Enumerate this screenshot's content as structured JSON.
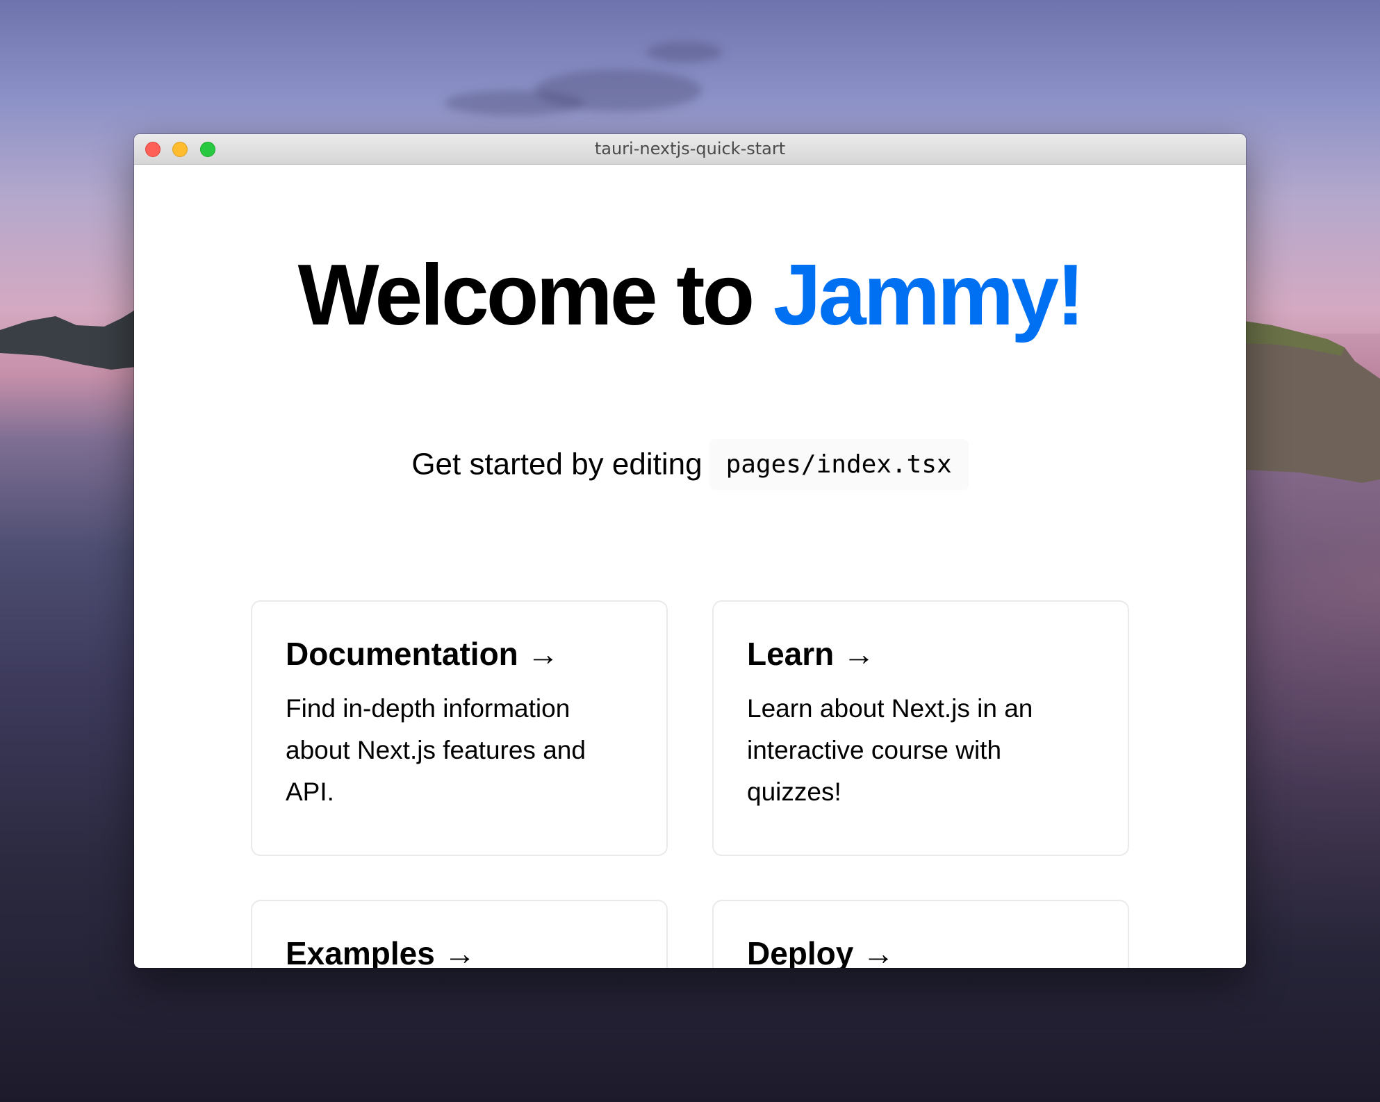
{
  "window": {
    "title": "tauri-nextjs-quick-start"
  },
  "main": {
    "title_prefix": "Welcome to ",
    "title_accent": "Jammy!",
    "description": "Get started by editing",
    "code": "pages/index.tsx"
  },
  "cards": [
    {
      "title": "Documentation →",
      "text": "Find in-depth information about Next.js features and API."
    },
    {
      "title": "Learn →",
      "text": "Learn about Next.js in an interactive course with quizzes!"
    },
    {
      "title": "Examples →",
      "text": ""
    },
    {
      "title": "Deploy →",
      "text": ""
    }
  ],
  "colors": {
    "accent": "#0070f3",
    "traffic_close": "#fe5f57",
    "traffic_minimize": "#febc2e",
    "traffic_zoom": "#28c840"
  }
}
